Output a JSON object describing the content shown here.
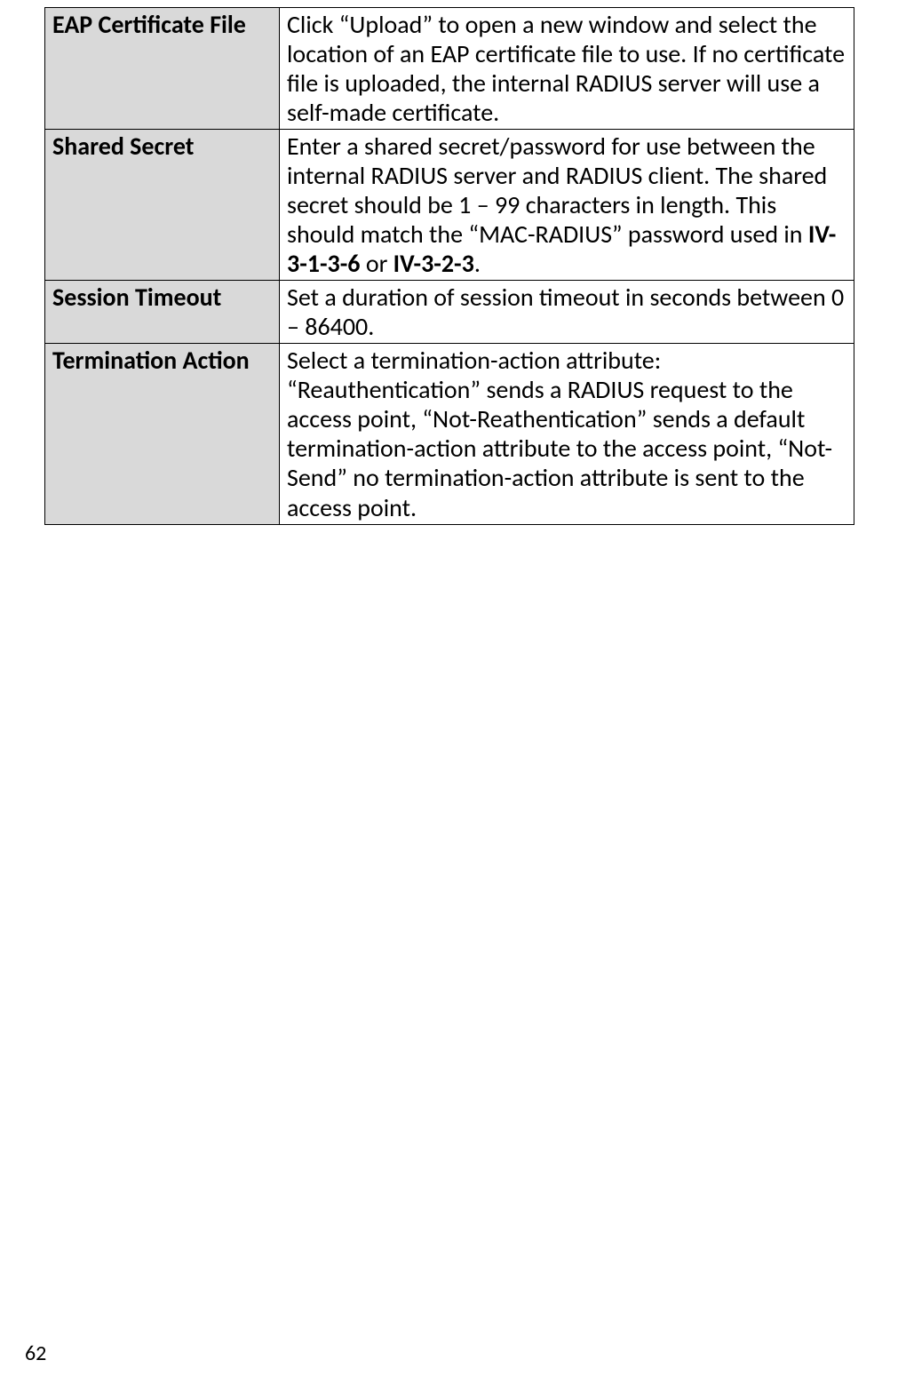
{
  "rows": [
    {
      "label": "EAP Certificate File",
      "desc_pre": "Click “Upload” to open a new window and select the location of an EAP certificate file to use. If no certificate file is uploaded, the internal RADIUS server will use a self-made certificate."
    },
    {
      "label": "Shared Secret",
      "desc_pre": "Enter a shared secret/password for use between the internal RADIUS server and RADIUS client. The shared secret should be 1 – 99 characters in length. This should match the “MAC-RADIUS” password used in ",
      "bold1": "IV-3-1-3-6",
      "mid": " or ",
      "bold2": "IV-3-2-3",
      "tail": "."
    },
    {
      "label": "Session Timeout",
      "desc_pre": "Set a duration of session timeout in seconds between 0 – 86400."
    },
    {
      "label": "Termination Action",
      "desc_pre": "Select a termination-action attribute: “Reauthentication” sends a RADIUS request to the access point, “Not-Reathentication” sends a default termination-action attribute to the access point, “Not-Send” no termination-action attribute is sent to the access point."
    }
  ],
  "page_number": "62"
}
